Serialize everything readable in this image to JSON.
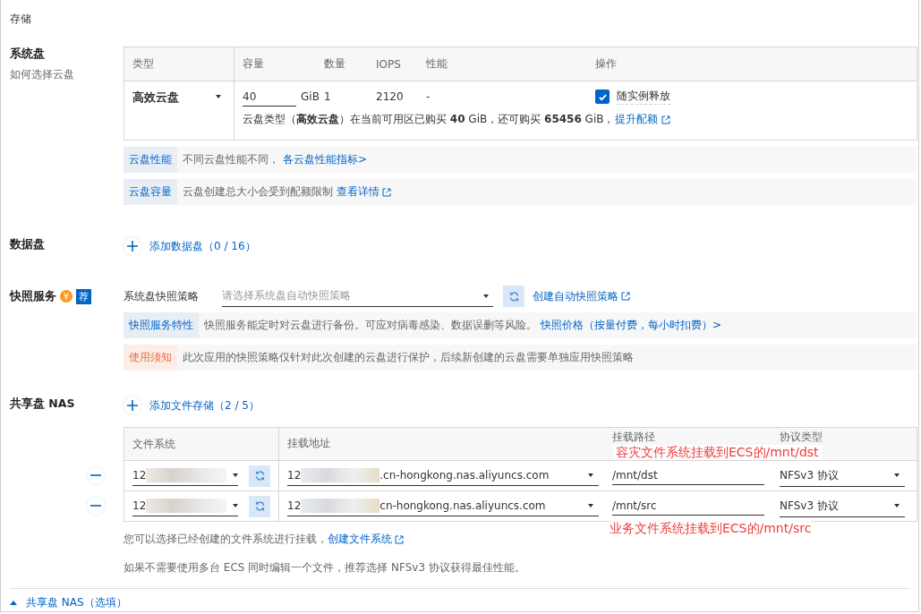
{
  "title": "存储",
  "system_disk": {
    "label": "系统盘",
    "help": "如何选择云盘",
    "columns": [
      "类型",
      "容量",
      "数量",
      "IOPS",
      "性能",
      "操作"
    ],
    "row": {
      "type": "高效云盘",
      "capacity": "40",
      "unit": "GiB",
      "count": "1",
      "iops": "2120",
      "performance": "-",
      "release_label": "随实例释放",
      "release_checked": true,
      "quota_note": "云盘类型（**高效云盘**）在当前可用区已购买 **40** GiB，还可购买 **65456** GiB，",
      "quota_link": "提升配额"
    },
    "notes": [
      {
        "kind": "info",
        "tag": "云盘性能",
        "text": "不同云盘性能不同，",
        "link": "各云盘性能指标>",
        "external": false
      },
      {
        "kind": "info",
        "tag": "云盘容量",
        "text": "云盘创建总大小会受到配额限制",
        "link": "查看详情",
        "external": true
      }
    ]
  },
  "data_disk": {
    "label": "数据盘",
    "add": "添加数据盘（0 / 16）"
  },
  "snapshot": {
    "label": "快照服务",
    "price_icon": "¥",
    "badge": "荐",
    "field_label": "系统盘快照策略",
    "placeholder": "请选择系统盘自动快照策略",
    "create_link": "创建自动快照策略",
    "notes": [
      {
        "kind": "info",
        "tag": "快照服务特性",
        "text": "快照服务能定时对云盘进行备份。可应对病毒感染、数据误删等风险。",
        "link": "快照价格（按量付费，每小时扣费）>",
        "external": false
      },
      {
        "kind": "warning",
        "tag": "使用须知",
        "text": "此次应用的快照策略仅针对此次创建的云盘进行保护，后续新创建的云盘需要单独应用快照策略"
      }
    ]
  },
  "nas": {
    "label": "共享盘 NAS",
    "add": "添加文件存储（2 / 5）",
    "columns": [
      "文件系统",
      "挂载地址",
      "挂载路径",
      "协议类型"
    ],
    "rows": [
      {
        "file_system": "12",
        "mount_prefix": "12",
        "mount_suffix": ".cn-hongkong.nas.aliyuncs.com",
        "path": "/mnt/dst",
        "protocol": "NFSv3 协议"
      },
      {
        "file_system": "12",
        "mount_prefix": "12",
        "mount_suffix": "cn-hongkong.nas.aliyuncs.com",
        "path": "/mnt/src",
        "protocol": "NFSv3 协议"
      }
    ],
    "annotations": [
      "容灾文件系统挂载到ECS的/mnt/dst",
      "业务文件系统挂载到ECS的/mnt/src"
    ],
    "hint": "您可以选择已经创建的文件系统进行挂载，",
    "hint_link": "创建文件系统",
    "hint2": "如果不需要使用多台 ECS 同时编辑一个文件，推荐选择 NFSv3 协议获得最佳性能。"
  },
  "footer": {
    "toggle": "共享盘 NAS（选填）"
  }
}
